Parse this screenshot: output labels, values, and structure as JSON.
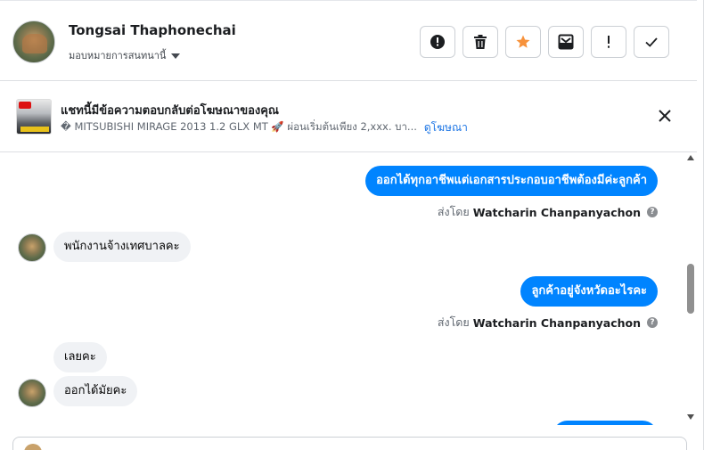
{
  "header": {
    "contact_name": "Tongsai Thaphonechai",
    "assign_label": "มอบหมายการสนทนานี้",
    "actions": [
      {
        "name": "exclamation-circle-icon"
      },
      {
        "name": "trash-icon"
      },
      {
        "name": "star-icon",
        "color": "#f7923b"
      },
      {
        "name": "archive-icon"
      },
      {
        "name": "exclamation-icon"
      },
      {
        "name": "check-icon"
      }
    ]
  },
  "ad": {
    "title": "แชทนี้มีข้อความตอบกลับต่อโฆษณาของคุณ",
    "description": "� MITSUBISHI MIRAGE 2013 1.2 GLX MT 🚀 ผ่อนเริ่มต้นเพียง 2,xxx. บา...",
    "link_label": "ดูโฆษณา"
  },
  "messages": [
    {
      "direction": "out",
      "text": "ออกได้ทุกอาชีพแต่เอกสารประกอบอาชีพต้องมีค่ะลูกค้า"
    },
    {
      "direction": "out-meta",
      "prefix": "ส่งโดย",
      "sender": "Watcharin Chanpanyachon",
      "help": "?"
    },
    {
      "direction": "in",
      "text": "พนักงานจ้างเทศบาลคะ"
    },
    {
      "direction": "out",
      "text": "ลูกค้าอยู่จังหวัดอะไรคะ"
    },
    {
      "direction": "out-meta",
      "prefix": "ส่งโดย",
      "sender": "Watcharin Chanpanyachon",
      "help": "?"
    },
    {
      "direction": "in",
      "text": "เลยคะ"
    },
    {
      "direction": "in",
      "text": "ออกได้มัยคะ"
    }
  ],
  "colors": {
    "outgoing_bubble": "#0084ff",
    "incoming_bubble": "#f0f2f5",
    "link": "#1b74e4"
  }
}
